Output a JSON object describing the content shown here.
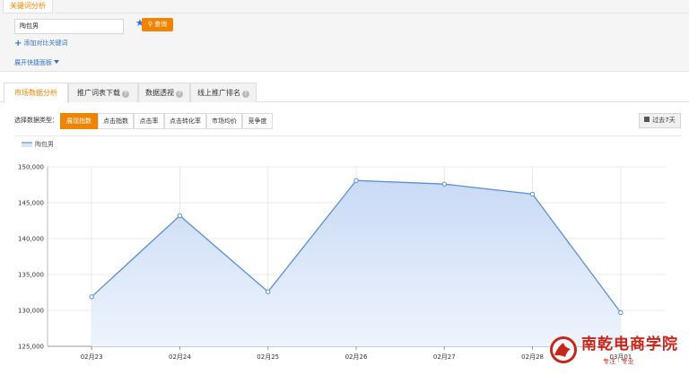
{
  "header": {
    "tab": "关键词分析"
  },
  "search": {
    "value": "陶包男",
    "query_label": "查询"
  },
  "links": {
    "add_compare": "添加对比关键词",
    "expand_panel": "展开快捷面板"
  },
  "tabs": [
    {
      "label": "市场数据分析",
      "active": true,
      "help": false
    },
    {
      "label": "推广词表下载",
      "active": false,
      "help": true
    },
    {
      "label": "数据透视",
      "active": false,
      "help": true
    },
    {
      "label": "线上推广排名",
      "active": false,
      "help": true
    }
  ],
  "metrics": {
    "label": "选择数据类型：",
    "items": [
      {
        "label": "展现指数",
        "active": true
      },
      {
        "label": "点击指数",
        "active": false
      },
      {
        "label": "点击率",
        "active": false
      },
      {
        "label": "点击转化率",
        "active": false
      },
      {
        "label": "市场均价",
        "active": false
      },
      {
        "label": "竞争度",
        "active": false
      }
    ]
  },
  "period": {
    "label": "过去7天"
  },
  "watermark": {
    "name": "南乾电商学院",
    "tagline": "专注 · 专业"
  },
  "chart_data": {
    "type": "area",
    "categories": [
      "02月23",
      "02月24",
      "02月25",
      "02月26",
      "02月27",
      "02月28",
      "03月01"
    ],
    "series": [
      {
        "name": "陶包男",
        "values": [
          131900,
          143200,
          132600,
          148100,
          147600,
          146200,
          129700
        ]
      }
    ],
    "yticks": [
      "125,000",
      "130,000",
      "135,000",
      "140,000",
      "145,000",
      "150,000"
    ],
    "ylim": [
      125000,
      150000
    ],
    "grid": true,
    "legend": "top-left",
    "colors": {
      "line": "#5b8fd9",
      "fill_top": "#c9daf5",
      "fill_bottom": "#eef4fd",
      "accent": "#f08300"
    }
  }
}
